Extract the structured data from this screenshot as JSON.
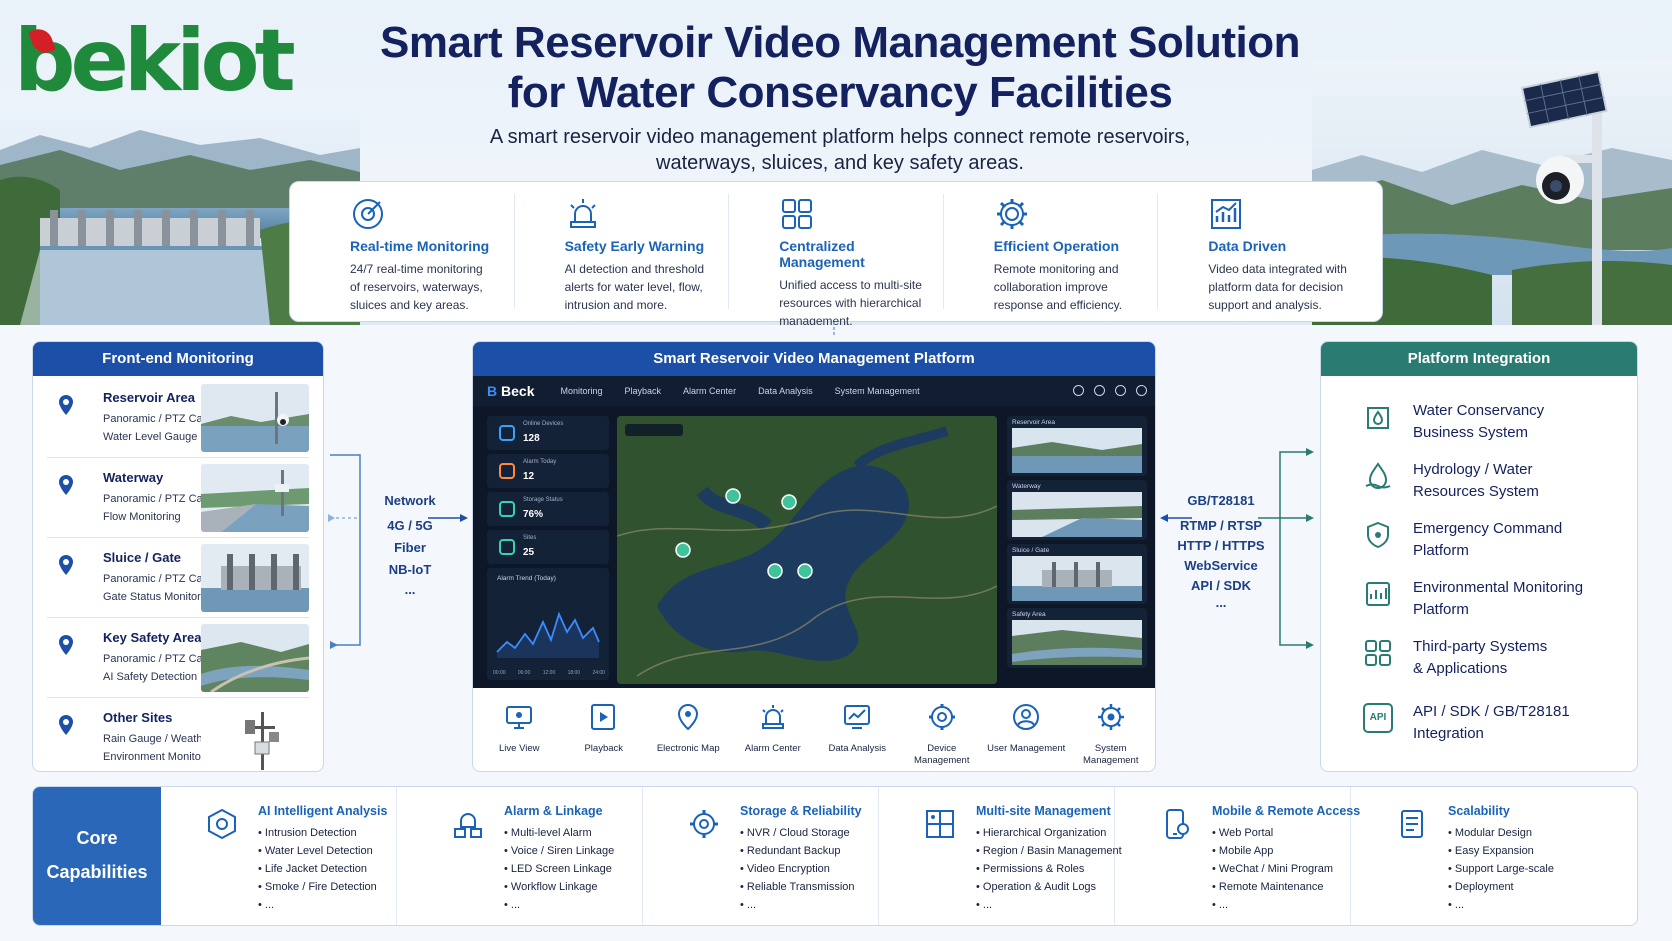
{
  "header": {
    "logo": "bekiot",
    "title_line1": "Smart Reservoir Video Management Solution",
    "title_line2": "for Water Conservancy Facilities",
    "subtitle_line1": "A smart reservoir video management platform helps connect remote reservoirs,",
    "subtitle_line2": "waterways, sluices, and key safety areas."
  },
  "features": [
    {
      "icon": "target-monitor-icon",
      "title": "Real-time Monitoring",
      "desc": [
        "24/7 real-time monitoring",
        "of reservoirs, waterways,",
        "sluices and key areas."
      ]
    },
    {
      "icon": "alarm-light-icon",
      "title": "Safety Early Warning",
      "desc": [
        "AI detection and threshold",
        "alerts for water level, flow,",
        "intrusion and more."
      ]
    },
    {
      "icon": "grid-icon",
      "title": "Centralized Management",
      "desc": [
        "Unified access to multi-site",
        "resources with hierarchical",
        "management."
      ]
    },
    {
      "icon": "gear-icon",
      "title": "Efficient Operation",
      "desc": [
        "Remote monitoring and",
        "collaboration improve",
        "response and efficiency."
      ]
    },
    {
      "icon": "chart-icon",
      "title": "Data Driven",
      "desc": [
        "Video data integrated with",
        "platform data for decision",
        "support and analysis."
      ]
    }
  ],
  "front_end": {
    "heading": "Front-end Monitoring",
    "sites": [
      {
        "title": "Reservoir Area",
        "l1": "Panoramic / PTZ Camera",
        "l2": "Water Level Gauge"
      },
      {
        "title": "Waterway",
        "l1": "Panoramic / PTZ Camera",
        "l2": "Flow Monitoring"
      },
      {
        "title": "Sluice / Gate",
        "l1": "Panoramic / PTZ Camera",
        "l2": "Gate Status Monitoring"
      },
      {
        "title": "Key Safety Areas",
        "l1": "Panoramic / PTZ Camera",
        "l2": "AI Safety Detection"
      },
      {
        "title": "Other Sites",
        "l1": "Rain Gauge / Weather Station",
        "l2": "Environment Monitor"
      }
    ]
  },
  "network": {
    "title": "Network",
    "items": [
      "4G / 5G",
      "Fiber",
      "NB-IoT",
      "..."
    ]
  },
  "protocols": {
    "items": [
      "GB/T28181",
      "RTMP / RTSP",
      "HTTP / HTTPS",
      "WebService",
      "API / SDK",
      "..."
    ]
  },
  "platform": {
    "heading": "Smart Reservoir Video Management Platform",
    "dashboard": {
      "logo": "Beck",
      "nav": [
        "Monitoring",
        "Playback",
        "Alarm Center",
        "Data Analysis",
        "System Management"
      ],
      "stats": [
        {
          "label": "Online Devices",
          "value": "128"
        },
        {
          "label": "Alarm Today",
          "value": "12"
        },
        {
          "label": "Storage Status",
          "value": "76%"
        },
        {
          "label": "Sites",
          "value": "25"
        }
      ],
      "trend_label": "Alarm Trend (Today)",
      "trend_x": [
        "00:00",
        "06:00",
        "12:00",
        "18:00",
        "24:00"
      ],
      "cameras": [
        "Reservoir Area",
        "Waterway",
        "Sluice / Gate",
        "Safety Area"
      ]
    },
    "functions": [
      {
        "label": "Live View",
        "icon": "monitor-icon"
      },
      {
        "label": "Playback",
        "icon": "playback-icon"
      },
      {
        "label": "Electronic Map",
        "icon": "map-icon"
      },
      {
        "label": "Alarm Center",
        "icon": "alarm-icon"
      },
      {
        "label": "Data Analysis",
        "icon": "analysis-icon"
      },
      {
        "label": "Device Management",
        "icon": "device-gear-icon"
      },
      {
        "label": "User Management",
        "icon": "user-icon"
      },
      {
        "label": "System Management",
        "icon": "system-gear-icon"
      }
    ]
  },
  "integration": {
    "heading": "Platform Integration",
    "items": [
      {
        "l1": "Water Conservancy",
        "l2": "Business System"
      },
      {
        "l1": "Hydrology / Water",
        "l2": "Resources System"
      },
      {
        "l1": "Emergency Command",
        "l2": "Platform"
      },
      {
        "l1": "Environmental Monitoring",
        "l2": "Platform"
      },
      {
        "l1": "Third-party Systems",
        "l2": "& Applications"
      },
      {
        "l1": "API / SDK / GB/T28181",
        "l2": "Integration",
        "badge": "API"
      }
    ]
  },
  "core": {
    "title_l1": "Core",
    "title_l2": "Capabilities",
    "groups": [
      {
        "title": "AI Intelligent Analysis",
        "items": [
          "Intrusion Detection",
          "Water Level Detection",
          "Life Jacket Detection",
          "Smoke / Fire Detection",
          "..."
        ]
      },
      {
        "title": "Alarm & Linkage",
        "items": [
          "Multi-level Alarm",
          "Voice / Siren Linkage",
          "LED Screen Linkage",
          "Workflow Linkage",
          "..."
        ]
      },
      {
        "title": "Storage & Reliability",
        "items": [
          "NVR / Cloud Storage",
          "Redundant Backup",
          "Video Encryption",
          "Reliable Transmission",
          "..."
        ]
      },
      {
        "title": "Multi-site Management",
        "items": [
          "Hierarchical Organization",
          "Region / Basin Management",
          "Permissions & Roles",
          "Operation & Audit Logs",
          "..."
        ]
      },
      {
        "title": "Mobile & Remote Access",
        "items": [
          "Web Portal",
          "Mobile App",
          "WeChat / Mini Program",
          "Remote Maintenance",
          "..."
        ]
      },
      {
        "title": "Scalability",
        "items": [
          "Modular Design",
          "Easy Expansion",
          "Support Large-scale",
          "Deployment",
          "..."
        ]
      }
    ]
  },
  "colors": {
    "brand_green": "#1f8a3b",
    "brand_red": "#d32027",
    "navy": "#13215e",
    "accent_blue": "#1a63b8",
    "teal": "#2a7c72"
  }
}
